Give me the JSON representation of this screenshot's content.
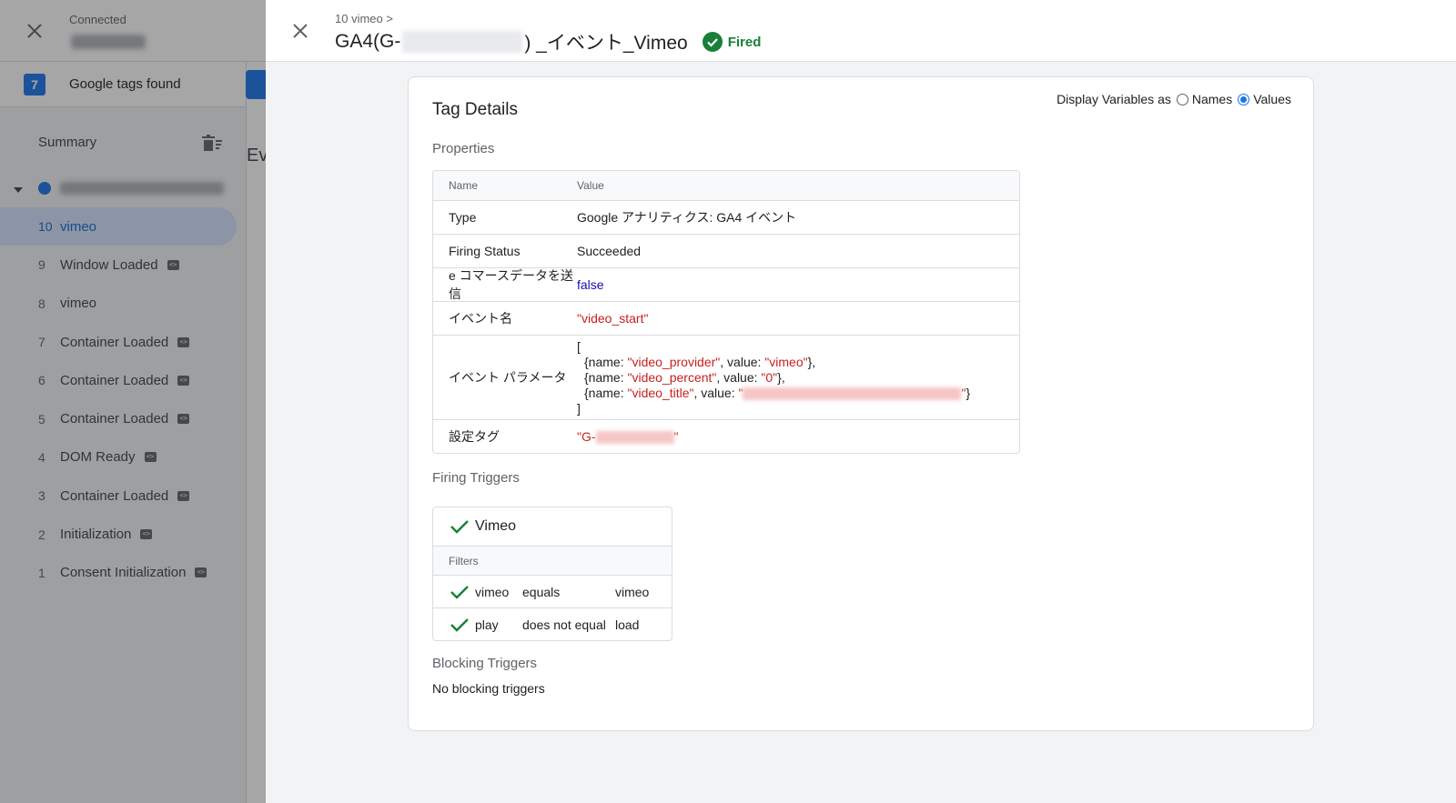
{
  "left_panel": {
    "status_label": "Connected",
    "tags_count": "7",
    "tags_label": "Google tags found",
    "summary_label": "Summary",
    "events_partial_heading": "Ev",
    "events": [
      {
        "num": "10",
        "label": "vimeo",
        "active": true,
        "badge": false
      },
      {
        "num": "9",
        "label": "Window Loaded",
        "active": false,
        "badge": true
      },
      {
        "num": "8",
        "label": "vimeo",
        "active": false,
        "badge": false
      },
      {
        "num": "7",
        "label": "Container Loaded",
        "active": false,
        "badge": true
      },
      {
        "num": "6",
        "label": "Container Loaded",
        "active": false,
        "badge": true
      },
      {
        "num": "5",
        "label": "Container Loaded",
        "active": false,
        "badge": true
      },
      {
        "num": "4",
        "label": "DOM Ready",
        "active": false,
        "badge": true
      },
      {
        "num": "3",
        "label": "Container Loaded",
        "active": false,
        "badge": true
      },
      {
        "num": "2",
        "label": "Initialization",
        "active": false,
        "badge": true
      },
      {
        "num": "1",
        "label": "Consent Initialization",
        "active": false,
        "badge": true
      }
    ]
  },
  "header": {
    "breadcrumb": "10 vimeo >",
    "title_prefix": "GA4(G-",
    "title_suffix": ") _イベント_Vimeo",
    "status": "Fired",
    "status_color": "#188038"
  },
  "details": {
    "title": "Tag Details",
    "display_vars_label": "Display Variables as",
    "display_options": [
      "Names",
      "Values"
    ],
    "display_selected": "Values",
    "properties_label": "Properties",
    "columns": [
      "Name",
      "Value"
    ],
    "rows": {
      "type": {
        "name": "Type",
        "value": "Google アナリティクス: GA4 イベント"
      },
      "firing_status": {
        "name": "Firing Status",
        "value": "Succeeded"
      },
      "ecommerce": {
        "name": "e コマースデータを送信",
        "value": "false"
      },
      "event_name": {
        "name": "イベント名",
        "value": "\"video_start\""
      },
      "event_params": {
        "name": "イベント パラメータ",
        "open": "[",
        "close": "]",
        "p1_a": "{name: ",
        "p1_n": "\"video_provider\"",
        "p1_b": ", value: ",
        "p1_v": "\"vimeo\"",
        "p1_c": "},",
        "p2_a": "{name: ",
        "p2_n": "\"video_percent\"",
        "p2_b": ", value: ",
        "p2_v": "\"0\"",
        "p2_c": "},",
        "p3_a": "{name: ",
        "p3_n": "\"video_title\"",
        "p3_b": ", value: ",
        "p3_q1": "\"",
        "p3_q2": "\"",
        "p3_c": "}"
      },
      "config_tag": {
        "name": "設定タグ",
        "value_prefix": "\"G-",
        "value_suffix": "\""
      }
    },
    "firing_triggers_label": "Firing Triggers",
    "trigger": {
      "name": "Vimeo",
      "filters_label": "Filters",
      "filters": [
        {
          "var": "vimeo",
          "op": "equals",
          "val": "vimeo"
        },
        {
          "var": "play",
          "op": "does not equal",
          "val": "load"
        }
      ]
    },
    "blocking_triggers_label": "Blocking Triggers",
    "no_blocking": "No blocking triggers"
  }
}
